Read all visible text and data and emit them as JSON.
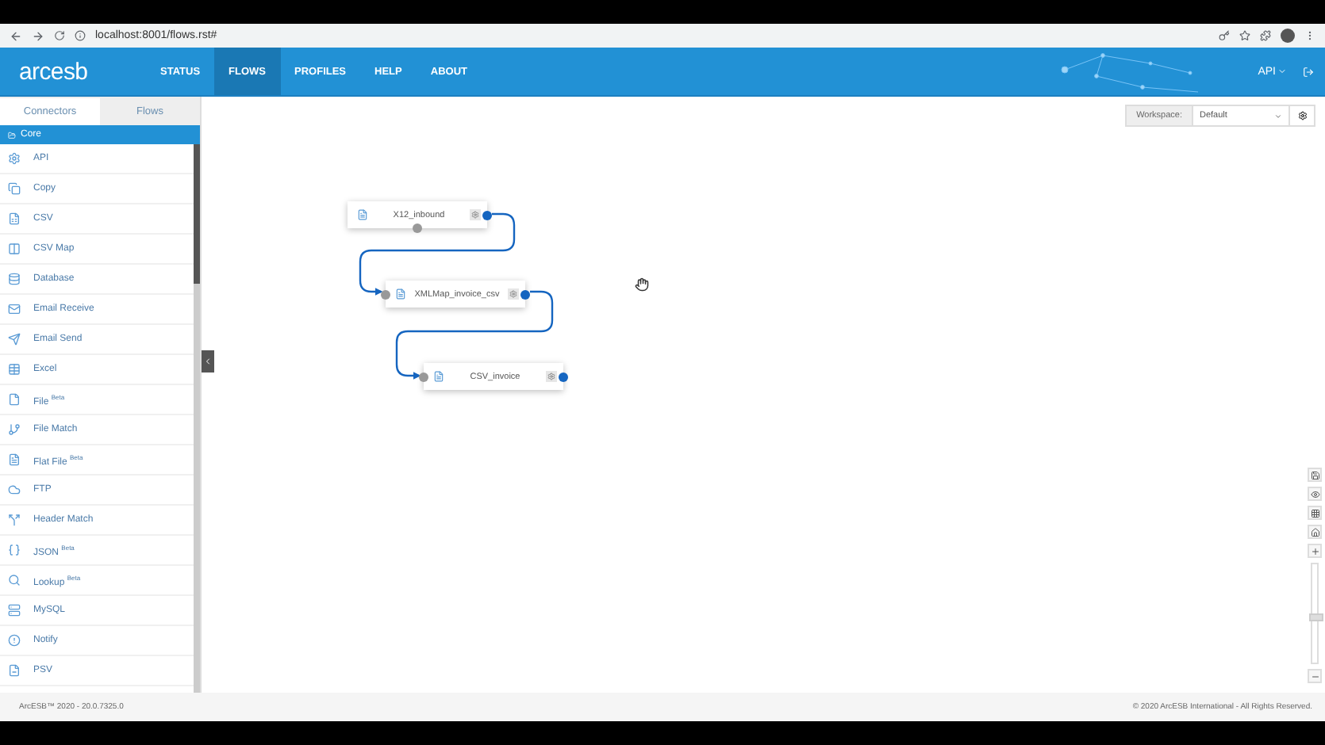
{
  "browser": {
    "url": "localhost:8001/flows.rst#"
  },
  "header": {
    "logo": "arcesb",
    "nav": [
      {
        "label": "STATUS",
        "selected": false
      },
      {
        "label": "FLOWS",
        "selected": true
      },
      {
        "label": "PROFILES",
        "selected": false
      },
      {
        "label": "HELP",
        "selected": false
      },
      {
        "label": "ABOUT",
        "selected": false
      }
    ],
    "api_menu": "API"
  },
  "sidebar": {
    "tabs": [
      {
        "label": "Connectors",
        "selected": true
      },
      {
        "label": "Flows",
        "selected": false
      }
    ],
    "group": "Core",
    "items": [
      {
        "label": "API"
      },
      {
        "label": "Copy"
      },
      {
        "label": "CSV"
      },
      {
        "label": "CSV Map"
      },
      {
        "label": "Database"
      },
      {
        "label": "Email Receive"
      },
      {
        "label": "Email Send"
      },
      {
        "label": "Excel"
      },
      {
        "label": "File $^{Beta}$"
      },
      {
        "label": "File Match"
      },
      {
        "label": "Flat File $^{Beta}$"
      },
      {
        "label": "FTP"
      },
      {
        "label": "Header Match"
      },
      {
        "label": "JSON $^{Beta}$"
      },
      {
        "label": "Lookup $^{Beta}$"
      },
      {
        "label": "MySQL"
      },
      {
        "label": "Notify"
      },
      {
        "label": "PSV"
      }
    ]
  },
  "workspace": {
    "label": "Workspace:",
    "value": "Default"
  },
  "flow": {
    "nodes": [
      {
        "name": "X12_inbound"
      },
      {
        "name": "XMLMap_invoice_csv"
      },
      {
        "name": "CSV_invoice"
      }
    ]
  },
  "zoom": {
    "level": 0.45
  },
  "footer": {
    "version": "ArcESB™ 2020 - 20.0.7325.0",
    "copyright": "© 2020 ArcESB International - All Rights Reserved."
  }
}
